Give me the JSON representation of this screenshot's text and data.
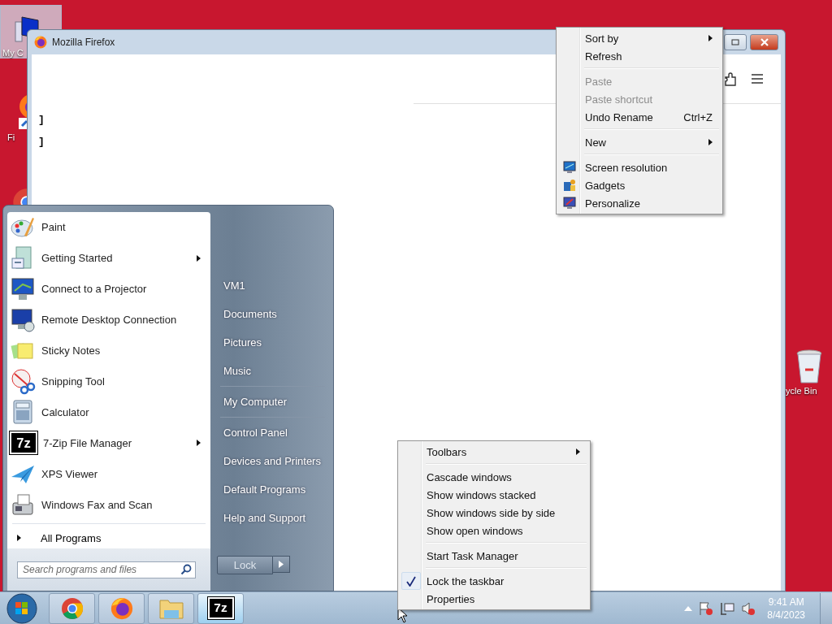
{
  "desktop_icons": [
    {
      "kind": "computer",
      "label": "My C",
      "selected": true
    },
    {
      "kind": "firefox",
      "label": "Fi",
      "selected": false
    },
    {
      "kind": "chrome",
      "selected": false
    },
    {
      "kind": "recycle",
      "label": "ycle Bin",
      "selected": false
    }
  ],
  "browser_window": {
    "title": "Mozilla Firefox",
    "lines": [
      "]",
      "]"
    ]
  },
  "start_menu": {
    "programs": [
      {
        "label": "Paint",
        "submenu": false
      },
      {
        "label": "Getting Started",
        "submenu": true
      },
      {
        "label": "Connect to a Projector",
        "submenu": false
      },
      {
        "label": "Remote Desktop Connection",
        "submenu": false
      },
      {
        "label": "Sticky Notes",
        "submenu": false
      },
      {
        "label": "Snipping Tool",
        "submenu": false
      },
      {
        "label": "Calculator",
        "submenu": false
      },
      {
        "logo_text": "7z",
        "label": "7-Zip File Manager",
        "submenu": true
      },
      {
        "label": "XPS Viewer",
        "submenu": false
      },
      {
        "label": "Windows Fax and Scan",
        "submenu": false
      }
    ],
    "all_programs": "All Programs",
    "search": {
      "placeholder": "Search programs and files"
    },
    "places": [
      {
        "label": "VM1",
        "divider_before": false
      },
      {
        "label": "Documents",
        "divider_before": false
      },
      {
        "label": "Pictures",
        "divider_before": false
      },
      {
        "label": "Music",
        "divider_before": false
      },
      {
        "label": "My Computer",
        "divider_before": true
      },
      {
        "label": "Control Panel",
        "divider_before": true
      },
      {
        "label": "Devices and Printers",
        "divider_before": false
      },
      {
        "label": "Default Programs",
        "divider_before": false
      },
      {
        "label": "Help and Support",
        "divider_before": false
      }
    ],
    "power_button": "Lock"
  },
  "desktop_menu": [
    {
      "kind": "item",
      "label": "Sort by",
      "submenu": true,
      "disabled": false
    },
    {
      "kind": "item",
      "label": "Refresh",
      "submenu": false,
      "disabled": false
    },
    {
      "kind": "separator"
    },
    {
      "kind": "item",
      "label": "Paste",
      "submenu": false,
      "disabled": true
    },
    {
      "kind": "item",
      "label": "Paste shortcut",
      "submenu": false,
      "disabled": true
    },
    {
      "kind": "item",
      "label": "Undo Rename",
      "shortcut": "Ctrl+Z",
      "submenu": false,
      "disabled": false
    },
    {
      "kind": "separator"
    },
    {
      "kind": "item",
      "label": "New",
      "submenu": true,
      "disabled": false
    },
    {
      "kind": "separator"
    },
    {
      "kind": "item",
      "label": "Screen resolution",
      "submenu": false,
      "disabled": false
    },
    {
      "kind": "item",
      "label": "Gadgets",
      "submenu": false,
      "disabled": false
    },
    {
      "kind": "item",
      "label": "Personalize",
      "submenu": false,
      "disabled": false
    }
  ],
  "taskbar_menu": [
    {
      "kind": "item",
      "label": "Toolbars",
      "submenu": true,
      "checked": false
    },
    {
      "kind": "separator"
    },
    {
      "kind": "item",
      "label": "Cascade windows",
      "submenu": false,
      "checked": false
    },
    {
      "kind": "item",
      "label": "Show windows stacked",
      "submenu": false,
      "checked": false
    },
    {
      "kind": "item",
      "label": "Show windows side by side",
      "submenu": false,
      "checked": false
    },
    {
      "kind": "item",
      "label": "Show open windows",
      "submenu": false,
      "checked": false
    },
    {
      "kind": "separator"
    },
    {
      "kind": "item",
      "label": "Start Task Manager",
      "submenu": false,
      "checked": false
    },
    {
      "kind": "separator"
    },
    {
      "kind": "item",
      "label": "Lock the taskbar",
      "submenu": false,
      "checked": true
    },
    {
      "kind": "item",
      "label": "Properties",
      "submenu": false,
      "checked": false
    }
  ],
  "taskbar": {
    "buttons": [
      {
        "kind": "chrome",
        "active": false
      },
      {
        "kind": "firefox",
        "active": false
      },
      {
        "kind": "explorer",
        "active": false
      },
      {
        "kind": "logo",
        "logo_text": "7z",
        "active": true
      }
    ],
    "clock": {
      "time": "9:41 AM",
      "date": "8/4/2023"
    }
  }
}
